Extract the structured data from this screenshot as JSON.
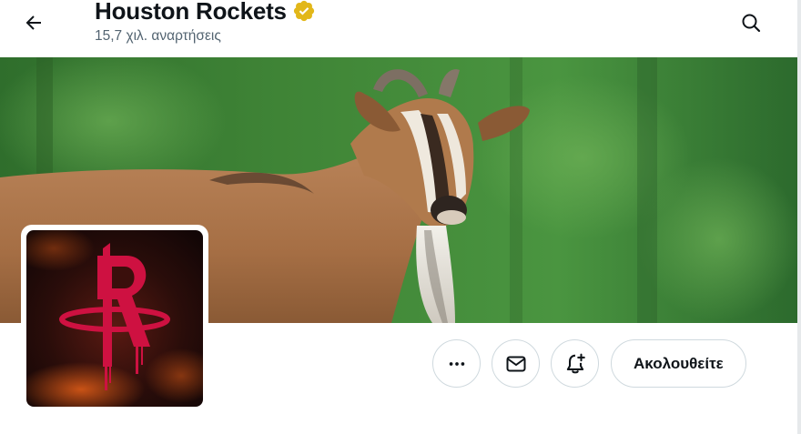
{
  "header": {
    "profile_name": "Houston Rockets",
    "posts_count": "15,7 χιλ. αναρτήσεις"
  },
  "colors": {
    "verified_badge": "#e2b719",
    "rockets_red": "#ce1141",
    "banner_green": "#3f8a3a"
  },
  "icons": {
    "back": "arrow-left-icon",
    "search": "search-icon",
    "verified": "verified-badge-icon",
    "more": "more-icon",
    "message": "mail-icon",
    "notifications": "bell-plus-icon"
  },
  "actions": {
    "follow_label": "Ακολουθείτε"
  }
}
